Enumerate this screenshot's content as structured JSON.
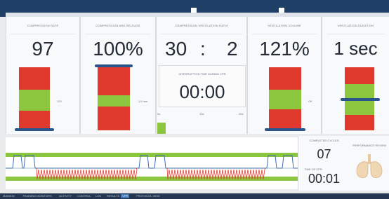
{
  "top_bar": {},
  "panels": {
    "compression_rate": {
      "label": "COMPRESSION RATE",
      "value": "97",
      "scale_label": "120"
    },
    "compression_release": {
      "label": "COMPRESSION AND RELEASE",
      "value": "100%",
      "scale_label": "1.8 mm"
    },
    "compression_ventilation_ratio": {
      "label": "COMPRESSION VENTILATION RATIO",
      "value_left": "30",
      "separator": ":",
      "value_right": "2"
    },
    "ventilation_volume": {
      "label": "VENTILATION VOLUME",
      "value": "121%",
      "scale_label": "OK"
    },
    "ventilation_duration": {
      "label": "VENTILATION DURATION",
      "value": "1 sec"
    }
  },
  "interruption": {
    "label": "INTERRUPTION TIME DURING CPR",
    "value": "00:00",
    "scale": [
      "0s",
      "10s",
      "20s"
    ]
  },
  "counter": {
    "cycles_label": "COMPLETED CYCLES",
    "cycles_value": "07",
    "time_label": "TIME OF CPR",
    "time_value": "00:01"
  },
  "lungs": {
    "label": "PERFORMANCE REVIEW"
  },
  "bottom_tabs": [
    {
      "label": "MANIKIN"
    },
    {
      "label": "TRAINING MONITORS"
    },
    {
      "label": "ACTIVITY"
    },
    {
      "label": "CONTROL"
    },
    {
      "label": "LOG"
    },
    {
      "label": "RESULTS"
    },
    {
      "label": "CPR"
    },
    {
      "label": "PROTOCOL VIEW"
    }
  ],
  "colors": {
    "gauge_red": "#e03a2f",
    "gauge_green": "#8cc63f",
    "marker_blue": "#2a558c",
    "top_bar": "#1f3f66",
    "active_tab": "#3f74b3"
  }
}
